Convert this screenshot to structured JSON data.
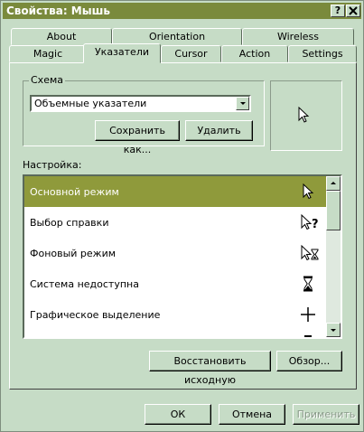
{
  "window": {
    "title": "Свойства: Мышь",
    "help_button": "?",
    "close_button": "X"
  },
  "tabs_top": [
    "About",
    "Orientation",
    "Wireless"
  ],
  "tabs_bottom": [
    "Magic",
    "Указатели",
    "Cursor",
    "Action",
    "Settings"
  ],
  "active_tab": "Указатели",
  "scheme": {
    "group_label": "Схема",
    "selected": "Объемные указатели",
    "save_as_label": "Сохранить как...",
    "delete_label": "Удалить"
  },
  "customize": {
    "label": "Настройка:",
    "items": [
      {
        "label": "Основной режим",
        "icon": "arrow-cursor-icon",
        "selected": true
      },
      {
        "label": "Выбор справки",
        "icon": "help-select-cursor-icon",
        "selected": false
      },
      {
        "label": "Фоновый режим",
        "icon": "working-in-background-cursor-icon",
        "selected": false
      },
      {
        "label": "Система недоступна",
        "icon": "busy-hourglass-cursor-icon",
        "selected": false
      },
      {
        "label": "Графическое выделение",
        "icon": "precision-select-cursor-icon",
        "selected": false
      }
    ],
    "restore_default_label": "Восстановить исходную",
    "browse_label": "Обзор..."
  },
  "footer": {
    "ok_label": "ОК",
    "cancel_label": "Отмена",
    "apply_label": "Применить"
  },
  "colors": {
    "face": "#c6dcc6",
    "titlebar": "#7a8a3c",
    "selection": "#8f9a3b"
  }
}
